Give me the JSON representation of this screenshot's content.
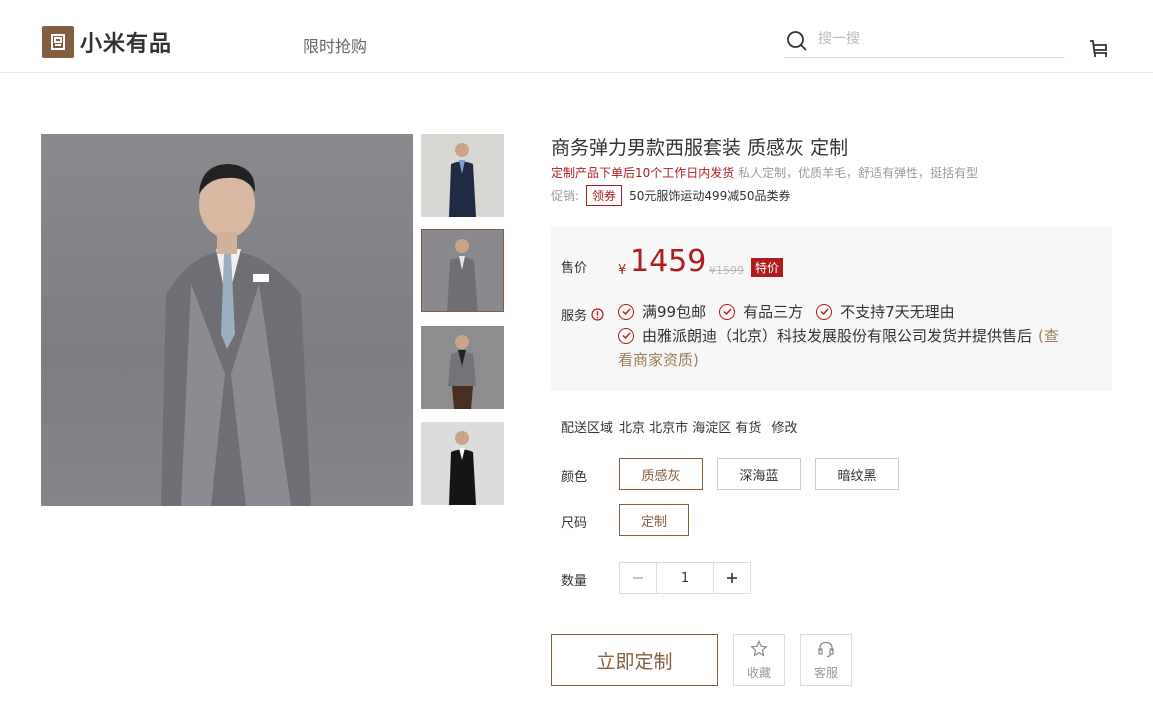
{
  "header": {
    "logo_text": "小米有品",
    "nav_flash": "限时抢购",
    "search_placeholder": "搜一搜"
  },
  "product": {
    "title": "商务弹力男款西服套装 质感灰 定制",
    "notice_red": "定制产品下单后10个工作日内发货",
    "notice_grey": "私人定制，优质羊毛，舒适有弹性，挺括有型",
    "promo_label": "促销:",
    "coupon_label": "领券",
    "promo_text": "50元服饰运动499减50品类券",
    "price_label": "售价",
    "currency": "¥",
    "price": "1459",
    "original_price": "¥1599",
    "price_tag": "特价",
    "service_label": "服务",
    "services_row1": [
      "满99包邮",
      "有品三方",
      "不支持7天无理由"
    ],
    "service_seller": "由雅派朗迪（北京）科技发展股份有限公司发货并提供售后",
    "service_link": "(查看商家资质)",
    "service_link_line1": "(查",
    "service_link_line2": "看商家资质)",
    "delivery_label": "配送区域",
    "delivery_value": "北京 北京市 海淀区 有货",
    "delivery_edit": "修改",
    "color_label": "颜色",
    "colors": [
      "质感灰",
      "深海蓝",
      "暗纹黑"
    ],
    "selected_color": "质感灰",
    "size_label": "尺码",
    "sizes": [
      "定制"
    ],
    "qty_label": "数量",
    "quantity": "1",
    "buy_label": "立即定制",
    "fav_label": "收藏",
    "service_btn_label": "客服"
  },
  "colors": {
    "brand": "#845f3f",
    "accent_red": "#b01b1b",
    "link_brown": "#9c7c5a"
  }
}
